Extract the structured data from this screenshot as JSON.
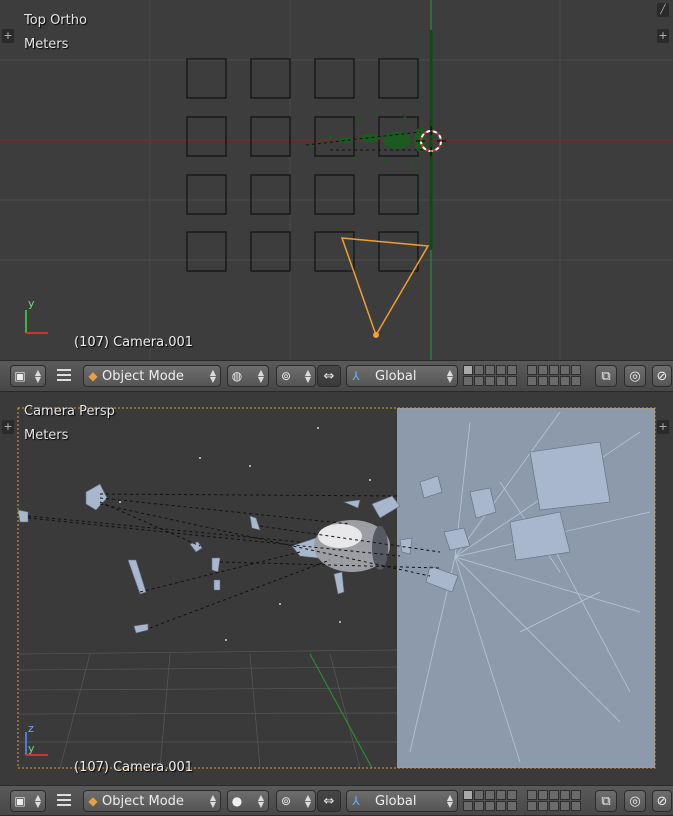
{
  "top_viewport": {
    "view_label": "Top Ortho",
    "units_label": "Meters",
    "object_info": "(107) Camera.001",
    "axis_y": "y"
  },
  "bottom_viewport": {
    "view_label": "Camera Persp",
    "units_label": "Meters",
    "object_info": "(107) Camera.001",
    "axis_z": "z",
    "axis_y": "y"
  },
  "top_header": {
    "mode_label": "Object Mode",
    "orientation_label": "Global",
    "icons": [
      "view3d-editor-icon",
      "menu-icon",
      "object-mode-cube-icon",
      "viewport-shading-wire-icon",
      "pivot-point-icon",
      "manipulator-icon",
      "transform-orientation-icon",
      "layers-grid",
      "render-layer-icon",
      "lock-icon",
      "proportional-edit-icon",
      "snap-icon"
    ]
  },
  "bottom_header": {
    "mode_label": "Object Mode",
    "orientation_label": "Global",
    "icons": [
      "view3d-editor-icon",
      "menu-icon",
      "object-mode-cube-icon",
      "viewport-shading-solid-icon",
      "pivot-point-icon",
      "manipulator-icon",
      "transform-orientation-icon",
      "layers-grid",
      "render-layer-icon",
      "lock-icon",
      "proportional-edit-icon",
      "snap-icon"
    ]
  },
  "colors": {
    "x_axis": "#8a2a2a",
    "y_axis": "#2e7d2e",
    "camera_selected": "#f0a030",
    "glass_wall": "#8c9aab",
    "viewport_bg": "#3d3d3d"
  }
}
